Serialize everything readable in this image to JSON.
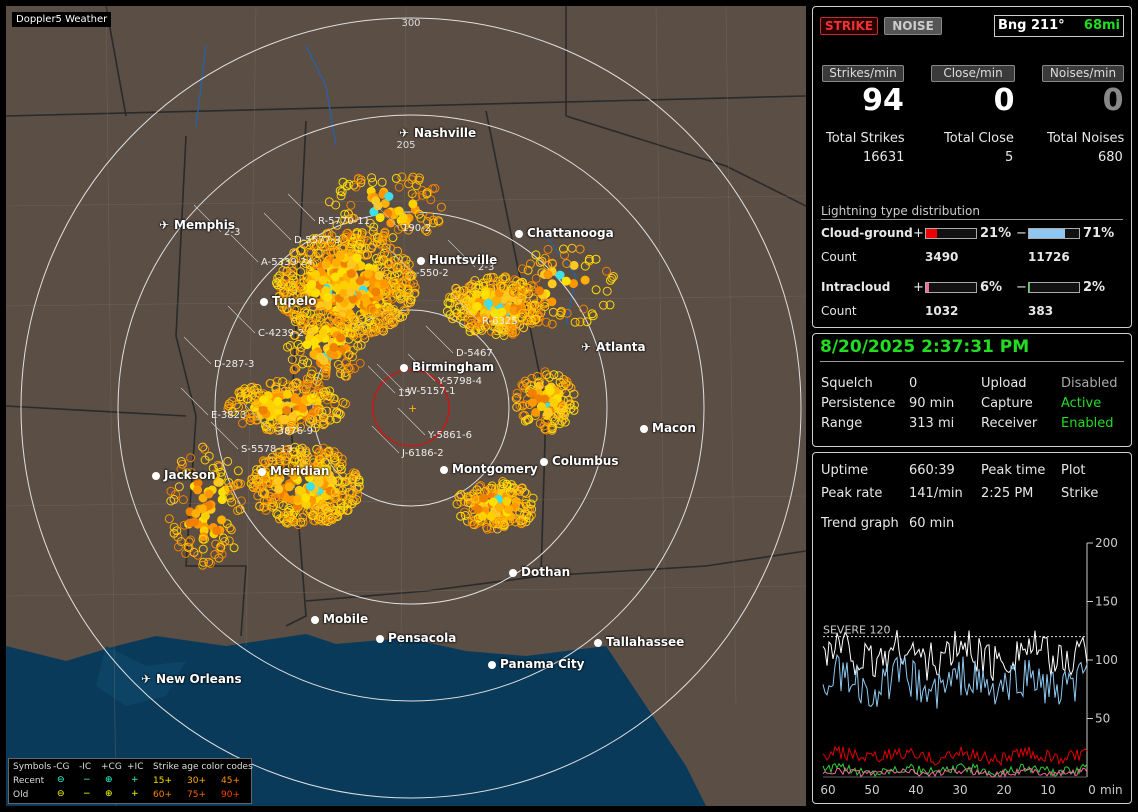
{
  "app_title": "Doppler5 Weather",
  "top": {
    "strike_label": "STRIKE",
    "noise_label": "NOISE",
    "bearing_label": "Bng 211°",
    "distance": "68mi"
  },
  "counters": {
    "strikes_label": "Strikes/min",
    "close_label": "Close/min",
    "noises_label": "Noises/min",
    "strikes_value": "94",
    "close_value": "0",
    "noises_value": "0",
    "total_strikes_label": "Total Strikes",
    "total_close_label": "Total Close",
    "total_noises_label": "Total Noises",
    "total_strikes": "16631",
    "total_close": "5",
    "total_noises": "680"
  },
  "distribution": {
    "title": "Lightning type distribution",
    "cg_label": "Cloud-ground",
    "cg_pos_pct": "21%",
    "cg_neg_pct": "71%",
    "cg_pos_fill": 0.21,
    "cg_neg_fill": 0.71,
    "count_label": "Count",
    "cg_pos_count": "3490",
    "cg_neg_count": "11726",
    "ic_label": "Intracloud",
    "ic_pos_pct": "6%",
    "ic_neg_pct": "2%",
    "ic_pos_fill": 0.06,
    "ic_neg_fill": 0.02,
    "ic_pos_count": "1032",
    "ic_neg_count": "383",
    "plus": "+",
    "minus": "−"
  },
  "status": {
    "datetime": "8/20/2025 2:37:31 PM",
    "squelch_label": "Squelch",
    "squelch_value": "0",
    "persistence_label": "Persistence",
    "persistence_value": "90 min",
    "range_label": "Range",
    "range_value": "313 mi",
    "upload_label": "Upload",
    "upload_value": "Disabled",
    "capture_label": "Capture",
    "capture_value": "Active",
    "receiver_label": "Receiver",
    "receiver_value": "Enabled"
  },
  "stats": {
    "uptime_label": "Uptime",
    "uptime_value": "660:39",
    "peak_time_label": "Peak time",
    "peak_time_value": "2:25 PM",
    "plot_label": "Plot",
    "plot_value": "Strike",
    "peak_rate_label": "Peak rate",
    "peak_rate_value": "141/min",
    "trend_label": "Trend graph",
    "trend_value": "60 min"
  },
  "chart_data": {
    "type": "line",
    "severe_label": "SEVERE 120",
    "severe_value": 120,
    "ylim": [
      0,
      200
    ],
    "yticks": [
      "200",
      "150",
      "100",
      "50"
    ],
    "xticks": [
      "60",
      "50",
      "40",
      "30",
      "20",
      "10",
      "0"
    ],
    "xunit": "min"
  },
  "map": {
    "range_rings": [
      "300",
      "205"
    ],
    "cities": [
      {
        "name": "Nashville"
      },
      {
        "name": "Memphis"
      },
      {
        "name": "Chattanooga"
      },
      {
        "name": "Huntsville"
      },
      {
        "name": "Tupelo"
      },
      {
        "name": "Atlanta"
      },
      {
        "name": "Birmingham"
      },
      {
        "name": "Macon"
      },
      {
        "name": "Jackson"
      },
      {
        "name": "Meridian"
      },
      {
        "name": "Montgomery"
      },
      {
        "name": "Columbus"
      },
      {
        "name": "Dothan"
      },
      {
        "name": "Mobile"
      },
      {
        "name": "Pensacola"
      },
      {
        "name": "Tallahassee"
      },
      {
        "name": "Panama City"
      },
      {
        "name": "New Orleans"
      }
    ],
    "storm_tags": [
      "R-5770-11",
      "D-5577-3",
      "A-5339-24",
      "C-4239-2",
      "D-287-3",
      "E-3823",
      "-3876-9",
      "S-5578-13",
      "190-2",
      "-550-2",
      "2-3",
      "2-3",
      "R-6325",
      "D-5467",
      "Y-5798-4",
      "W-5157-1",
      "Y-5861-6",
      "J-6186-2",
      "15"
    ]
  },
  "legend": {
    "symbols_label": "Symbols",
    "neg_cg": "-CG",
    "neg_ic": "-IC",
    "pos_cg": "+CG",
    "pos_ic": "+IC",
    "age_label": "Strike age color codes",
    "recent_label": "Recent",
    "old_label": "Old",
    "a15": "15+",
    "a30": "30+",
    "a45": "45+",
    "a60": "60+",
    "a75": "75+",
    "a90": "90+"
  }
}
